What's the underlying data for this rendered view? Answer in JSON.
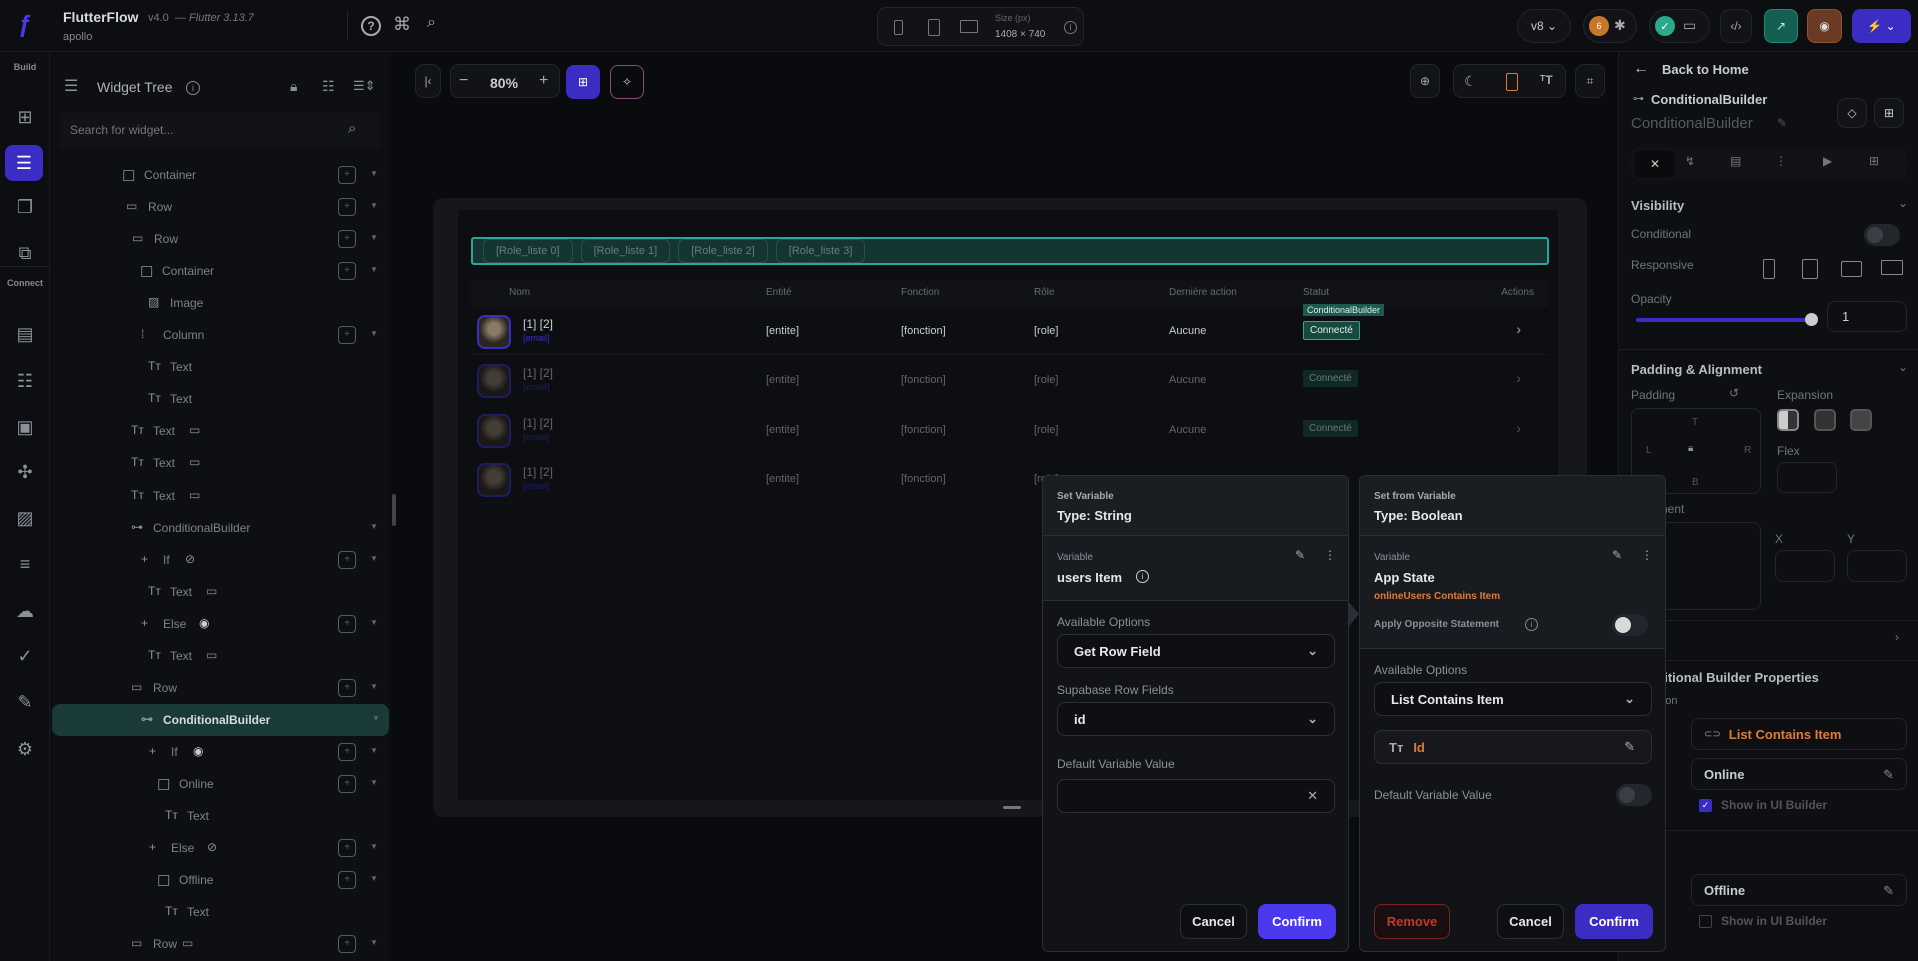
{
  "app": {
    "name": "FlutterFlow",
    "version": "v4.0",
    "flutter": "— Flutter 3.13.7",
    "project": "apollo"
  },
  "topbar": {
    "size_label": "Size (px)",
    "size_value": "1408 × 740",
    "version_pill": "v8",
    "badge_count": "6"
  },
  "rail": {
    "build_label": "Build",
    "connect_label": "Connect"
  },
  "widget_tree": {
    "title": "Widget Tree",
    "search_placeholder": "Search for widget...",
    "items": [
      {
        "label": "Container",
        "icon": "container",
        "level": 0,
        "add": true
      },
      {
        "label": "Row",
        "icon": "row",
        "level": 0.4,
        "add": true
      },
      {
        "label": "Row",
        "icon": "row",
        "level": 1,
        "add": true
      },
      {
        "label": "Container",
        "icon": "container",
        "level": 1.8,
        "add": true
      },
      {
        "label": "Image",
        "icon": "image",
        "level": 2.6,
        "add": false
      },
      {
        "label": "Column",
        "icon": "column",
        "level": 1.9,
        "add": true
      },
      {
        "label": "Text",
        "icon": "text",
        "level": 2.6,
        "add": false
      },
      {
        "label": "Text",
        "icon": "text",
        "level": 2.6,
        "add": false
      },
      {
        "label": "Text",
        "icon": "text",
        "level": 0.9,
        "add": false,
        "device": true
      },
      {
        "label": "Text",
        "icon": "text",
        "level": 0.9,
        "add": false,
        "device": true
      },
      {
        "label": "Text",
        "icon": "text",
        "level": 0.9,
        "add": false,
        "device": true
      },
      {
        "label": "ConditionalBuilder",
        "icon": "conditional",
        "level": 0.9,
        "add": false
      },
      {
        "label": "If",
        "icon": "plus",
        "level": 1.9,
        "add": true,
        "vis": "hidden"
      },
      {
        "label": "Text",
        "icon": "text",
        "level": 2.6,
        "add": false,
        "device": true
      },
      {
        "label": "Else",
        "icon": "plus",
        "level": 1.9,
        "add": true,
        "vis": "visible"
      },
      {
        "label": "Text",
        "icon": "text",
        "level": 2.6,
        "add": false,
        "device": true
      },
      {
        "label": "Row",
        "icon": "row",
        "level": 0.9,
        "add": true
      },
      {
        "label": "ConditionalBuilder",
        "icon": "conditional",
        "level": 1.7,
        "add": false,
        "selected": true
      },
      {
        "label": "If",
        "icon": "plus",
        "level": 2.7,
        "add": true,
        "vis": "visible"
      },
      {
        "label": "Online",
        "icon": "container",
        "level": 3.5,
        "add": true
      },
      {
        "label": "Text",
        "icon": "text",
        "level": 4.3,
        "add": false
      },
      {
        "label": "Else",
        "icon": "plus",
        "level": 2.7,
        "add": true,
        "vis": "hidden"
      },
      {
        "label": "Offline",
        "icon": "container",
        "level": 3.5,
        "add": true
      },
      {
        "label": "Text",
        "icon": "text",
        "level": 4.3,
        "add": false
      },
      {
        "label": "Row",
        "icon": "row",
        "level": 0.9,
        "add": true,
        "device": true
      }
    ]
  },
  "canvas": {
    "zoom": "80%",
    "tabs": [
      "[Role_liste 0]",
      "[Role_liste 1]",
      "[Role_liste 2]",
      "[Role_liste 3]"
    ],
    "columns": [
      "Nom",
      "Entité",
      "Fonction",
      "Rôle",
      "Dernière action",
      "Statut",
      "Actions"
    ],
    "rows": [
      {
        "name": "[1] [2]",
        "email": "[email]",
        "entite": "[entite]",
        "fonction": "[fonction]",
        "role": "[role]",
        "action": "Aucune",
        "statut": "Connecté"
      },
      {
        "name": "[1] [2]",
        "email": "[email]",
        "entite": "[entite]",
        "fonction": "[fonction]",
        "role": "[role]",
        "action": "Aucune",
        "statut": "Connecté"
      },
      {
        "name": "[1] [2]",
        "email": "[email]",
        "entite": "[entite]",
        "fonction": "[fonction]",
        "role": "[role]",
        "action": "Aucune",
        "statut": "Connecté"
      },
      {
        "name": "[1] [2]",
        "email": "[email]",
        "entite": "[entite]",
        "fonction": "[fonction]",
        "role": "[role]",
        "action": "",
        "statut": ""
      }
    ],
    "selected_badge": "ConditionalBuilder"
  },
  "dialog_set": {
    "title": "Set Variable",
    "type": "Type: String",
    "variable_label": "Variable",
    "variable_value": "users Item",
    "options_label": "Available Options",
    "options_value": "Get Row Field",
    "fields_label": "Supabase Row Fields",
    "fields_value": "id",
    "default_label": "Default Variable Value",
    "default_value": "",
    "cancel": "Cancel",
    "confirm": "Confirm"
  },
  "dialog_from": {
    "title": "Set from Variable",
    "type": "Type: Boolean",
    "variable_label": "Variable",
    "variable_value": "App State",
    "expression": "onlineUsers Contains Item",
    "opposite_label": "Apply Opposite Statement",
    "opposite_on": false,
    "options_label": "Available Options",
    "options_value": "List Contains Item",
    "item_value": "Id",
    "default_label": "Default Variable Value",
    "remove": "Remove",
    "cancel": "Cancel",
    "confirm": "Confirm"
  },
  "right_panel": {
    "back": "Back to Home",
    "widget_type": "ConditionalBuilder",
    "widget_name": "ConditionalBuilder",
    "visibility": "Visibility",
    "conditional": "Conditional",
    "responsive": "Responsive",
    "opacity": "Opacity",
    "opacity_value": "1",
    "padding_alignment": "Padding & Alignment",
    "padding": "Padding",
    "expansion": "Expansion",
    "flex": "Flex",
    "pad_t": "T",
    "pad_l": "L",
    "pad_r": "R",
    "pad_b": "B",
    "alignment": "Alignment",
    "x": "X",
    "y": "Y",
    "cb_props": "Conditional Builder Properties",
    "condition": "Condition",
    "condition_value": "List Contains Item",
    "if_name": "Online",
    "if_show": "Show in UI Builder",
    "if_show_checked": true,
    "else_name": "Offline",
    "else_show": "Show in UI Builder",
    "else_show_checked": false
  },
  "colors": {
    "accent": "#4b39ef",
    "teal": "#1a3a39",
    "orange": "#e07a3a",
    "danger": "#c0392b"
  }
}
